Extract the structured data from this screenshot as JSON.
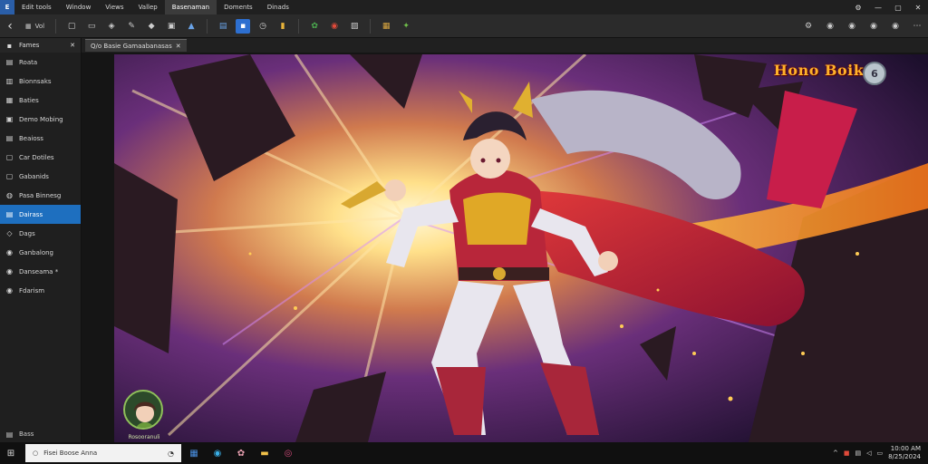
{
  "app": {
    "icon_text": "E"
  },
  "menus": [
    {
      "label": "Edit tools"
    },
    {
      "label": "Window"
    },
    {
      "label": "Views"
    },
    {
      "label": "Vallep"
    },
    {
      "label": "Basenaman"
    },
    {
      "label": "Doments"
    },
    {
      "label": "Dinads"
    }
  ],
  "window_controls": {
    "minimize": "—",
    "maximize": "▢",
    "close": "✕"
  },
  "toolbar": {
    "address": "Vol",
    "right_icons": [
      "⚙",
      "◉",
      "◉",
      "◉",
      "◉",
      "⋯"
    ]
  },
  "sidebar": {
    "header": "Fames",
    "close": "✕",
    "items": [
      {
        "label": "Roata",
        "icon": "folder-icon",
        "glyph": "▤"
      },
      {
        "label": "Bionnsaks",
        "icon": "book-icon",
        "glyph": "▥"
      },
      {
        "label": "Baties",
        "icon": "page-icon",
        "glyph": "▦"
      },
      {
        "label": "Demo Mobing",
        "icon": "media-icon",
        "glyph": "▣"
      },
      {
        "label": "Beaioss",
        "icon": "folder-icon",
        "glyph": "▤"
      },
      {
        "label": "Car Dotiles",
        "icon": "file-icon",
        "glyph": "▢"
      },
      {
        "label": "Gabanids",
        "icon": "file-icon",
        "glyph": "▢"
      },
      {
        "label": "Pasa Binnesg",
        "icon": "gear-icon",
        "glyph": "◍"
      },
      {
        "label": "Dairass",
        "icon": "page-icon",
        "glyph": "▤",
        "selected": true
      },
      {
        "label": "Dags",
        "icon": "tag-icon",
        "glyph": "◇"
      },
      {
        "label": "Ganbalong",
        "icon": "globe-icon",
        "glyph": "◉"
      },
      {
        "label": "Danseama *",
        "icon": "globe-icon",
        "glyph": "◉"
      },
      {
        "label": "Fdarism",
        "icon": "globe-icon",
        "glyph": "◉"
      }
    ],
    "footer": {
      "icon_glyph": "▤",
      "label": "Bass"
    }
  },
  "document": {
    "tab_label": "Q/o Basie Gamaabanasas",
    "tab_close": "✕"
  },
  "artwork": {
    "logo_text": "Hono Boike",
    "logo_badge": "6",
    "avatar_caption": "Rosooranuli"
  },
  "taskbar": {
    "search_placeholder": "Fisei Boose Anna",
    "clock_time": "10:00 AM",
    "clock_date": "8/25/2024"
  },
  "colors": {
    "accent": "#1e6fbf",
    "titlebar": "#202020",
    "toolbar": "#2b2b2b",
    "sidebar": "#1f1f1f",
    "taskbar": "#101010"
  }
}
